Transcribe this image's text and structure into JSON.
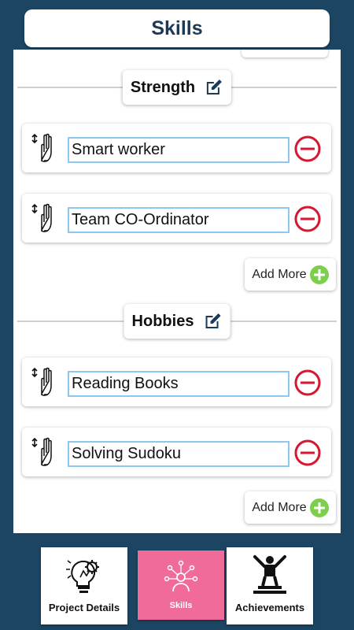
{
  "header": {
    "title": "Skills"
  },
  "sections": [
    {
      "title": "Strength",
      "items": [
        "Smart worker",
        "Team CO-Ordinator"
      ],
      "add_more_label": "Add More"
    },
    {
      "title": "Hobbies",
      "items": [
        "Reading Books",
        "Solving Sudoku"
      ],
      "add_more_label": "Add More"
    }
  ],
  "tabs": [
    {
      "label": "Project Details",
      "icon": "lightbulb-gear-icon"
    },
    {
      "label": "Skills",
      "icon": "person-network-icon",
      "active": true
    },
    {
      "label": "Achievements",
      "icon": "trophy-person-icon"
    }
  ],
  "colors": {
    "background": "#1b4562",
    "title_text": "#1b3a57",
    "remove_red": "#d7172f",
    "add_green": "#7ccf4d",
    "input_border": "#8ec8ee",
    "active_tab": "#f06a9a"
  }
}
